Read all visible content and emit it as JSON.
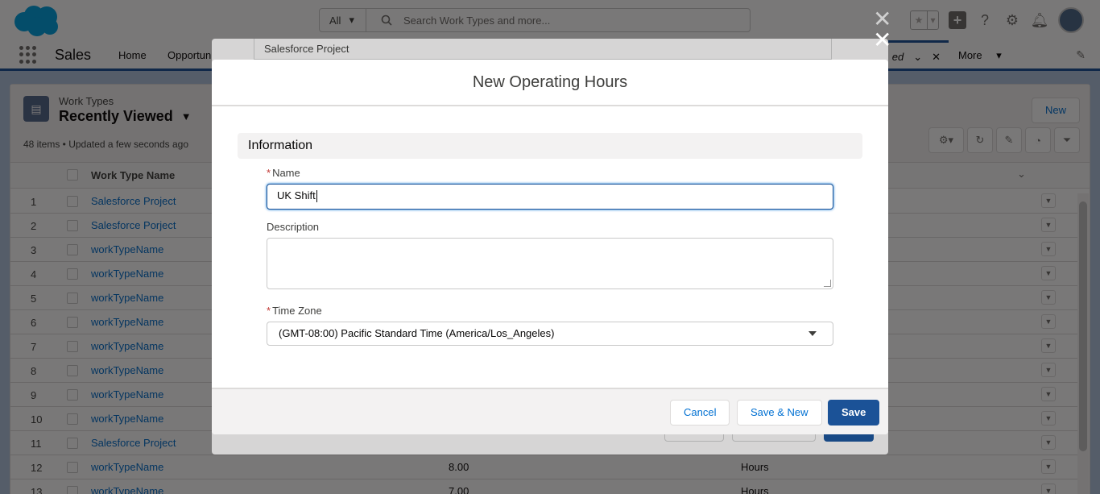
{
  "header": {
    "search_scope": "All",
    "search_placeholder": "Search Work Types and more..."
  },
  "nav": {
    "app_name": "Sales",
    "items": [
      "Home",
      "Opportun"
    ],
    "active_tab_label": "ed",
    "more_label": "More"
  },
  "list_view": {
    "object_name": "Work Types",
    "title": "Recently Viewed",
    "meta": "48 items • Updated a few seconds ago",
    "new_label": "New",
    "column_header": "Work Type Name",
    "rows": [
      {
        "num": "1",
        "name": "Salesforce Project",
        "v1": "",
        "v2": ""
      },
      {
        "num": "2",
        "name": "Salesforce Porject",
        "v1": "",
        "v2": ""
      },
      {
        "num": "3",
        "name": "workTypeName",
        "v1": "",
        "v2": ""
      },
      {
        "num": "4",
        "name": "workTypeName",
        "v1": "",
        "v2": ""
      },
      {
        "num": "5",
        "name": "workTypeName",
        "v1": "",
        "v2": ""
      },
      {
        "num": "6",
        "name": "workTypeName",
        "v1": "",
        "v2": ""
      },
      {
        "num": "7",
        "name": "workTypeName",
        "v1": "",
        "v2": ""
      },
      {
        "num": "8",
        "name": "workTypeName",
        "v1": "",
        "v2": ""
      },
      {
        "num": "9",
        "name": "workTypeName",
        "v1": "",
        "v2": ""
      },
      {
        "num": "10",
        "name": "workTypeName",
        "v1": "",
        "v2": ""
      },
      {
        "num": "11",
        "name": "Salesforce Project",
        "v1": "",
        "v2": ""
      },
      {
        "num": "12",
        "name": "workTypeName",
        "v1": "8.00",
        "v2": "Hours"
      },
      {
        "num": "13",
        "name": "workTypeName",
        "v1": "7.00",
        "v2": "Hours"
      }
    ]
  },
  "underlying_modal": {
    "field_value": "Salesforce Project"
  },
  "modal": {
    "title": "New Operating Hours",
    "section_title": "Information",
    "name_label": "Name",
    "name_value": "UK Shift",
    "description_label": "Description",
    "description_value": "",
    "timezone_label": "Time Zone",
    "timezone_value": "(GMT-08:00) Pacific Standard Time (America/Los_Angeles)",
    "cancel_label": "Cancel",
    "save_new_label": "Save & New",
    "save_label": "Save"
  },
  "colors": {
    "brand": "#1b5297",
    "link": "#006dcc",
    "nav_bg": "#ffffff",
    "required": "#c23934"
  },
  "icons": [
    "salesforce-cloud-logo",
    "search-icon",
    "star-icon",
    "plus-icon",
    "help-icon",
    "gear-icon",
    "bell-icon",
    "avatar",
    "waffle-icon",
    "list-icon",
    "close-icon",
    "refresh-icon",
    "pencil-icon",
    "filter-icon",
    "chevron-down-icon"
  ]
}
